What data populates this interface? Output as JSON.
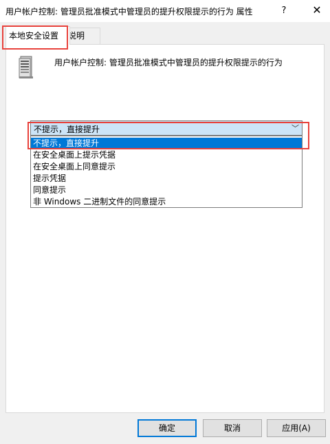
{
  "window": {
    "title": "用户帐户控制: 管理员批准模式中管理员的提升权限提示的行为 属性",
    "help_label": "?",
    "close_label": "✕"
  },
  "tabs": [
    {
      "label": "本地安全设置"
    },
    {
      "label": "说明"
    }
  ],
  "policy": {
    "name": "用户帐户控制: 管理员批准模式中管理员的提升权限提示的行为",
    "icon": "server-icon"
  },
  "combo": {
    "selected": "不提示，直接提升",
    "arrow": "﹀"
  },
  "options": [
    {
      "label": "不提示，直接提升"
    },
    {
      "label": "在安全桌面上提示凭据"
    },
    {
      "label": "在安全桌面上同意提示"
    },
    {
      "label": "提示凭据"
    },
    {
      "label": "同意提示"
    },
    {
      "label": "非 Windows 二进制文件的同意提示"
    }
  ],
  "buttons": {
    "ok": "确定",
    "cancel": "取消",
    "apply": "应用(A)"
  },
  "colors": {
    "highlight": "#e8413b",
    "selection": "#0078d7",
    "combo_bg": "#cce4f7"
  }
}
